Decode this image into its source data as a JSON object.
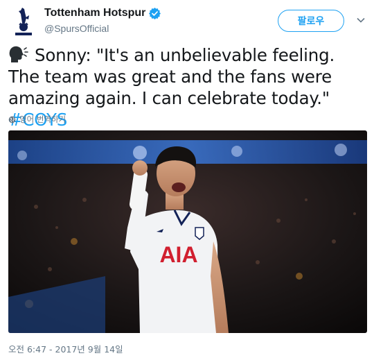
{
  "header": {
    "display_name": "Tottenham Hotspur",
    "handle": "@SpursOfficial",
    "follow_label": "팔로우"
  },
  "tweet": {
    "text": "Sonny: \"It's an unbelievable feeling. The team was great and the fans were amazing again. I can celebrate today.\" ",
    "hashtag": "#COYS",
    "translate_label": "영어 번역하기",
    "timestamp": "오전 6:47 - 2017년 9월 14일"
  },
  "photo": {
    "shirt_sponsor": "AIA"
  },
  "colors": {
    "link_blue": "#1da1f2",
    "text": "#14171a",
    "secondary": "#657786",
    "navy": "#132257"
  },
  "icons": [
    "spurs-logo-icon",
    "verified-badge-icon",
    "chevron-down-icon",
    "speaking-head-icon",
    "globe-icon"
  ]
}
